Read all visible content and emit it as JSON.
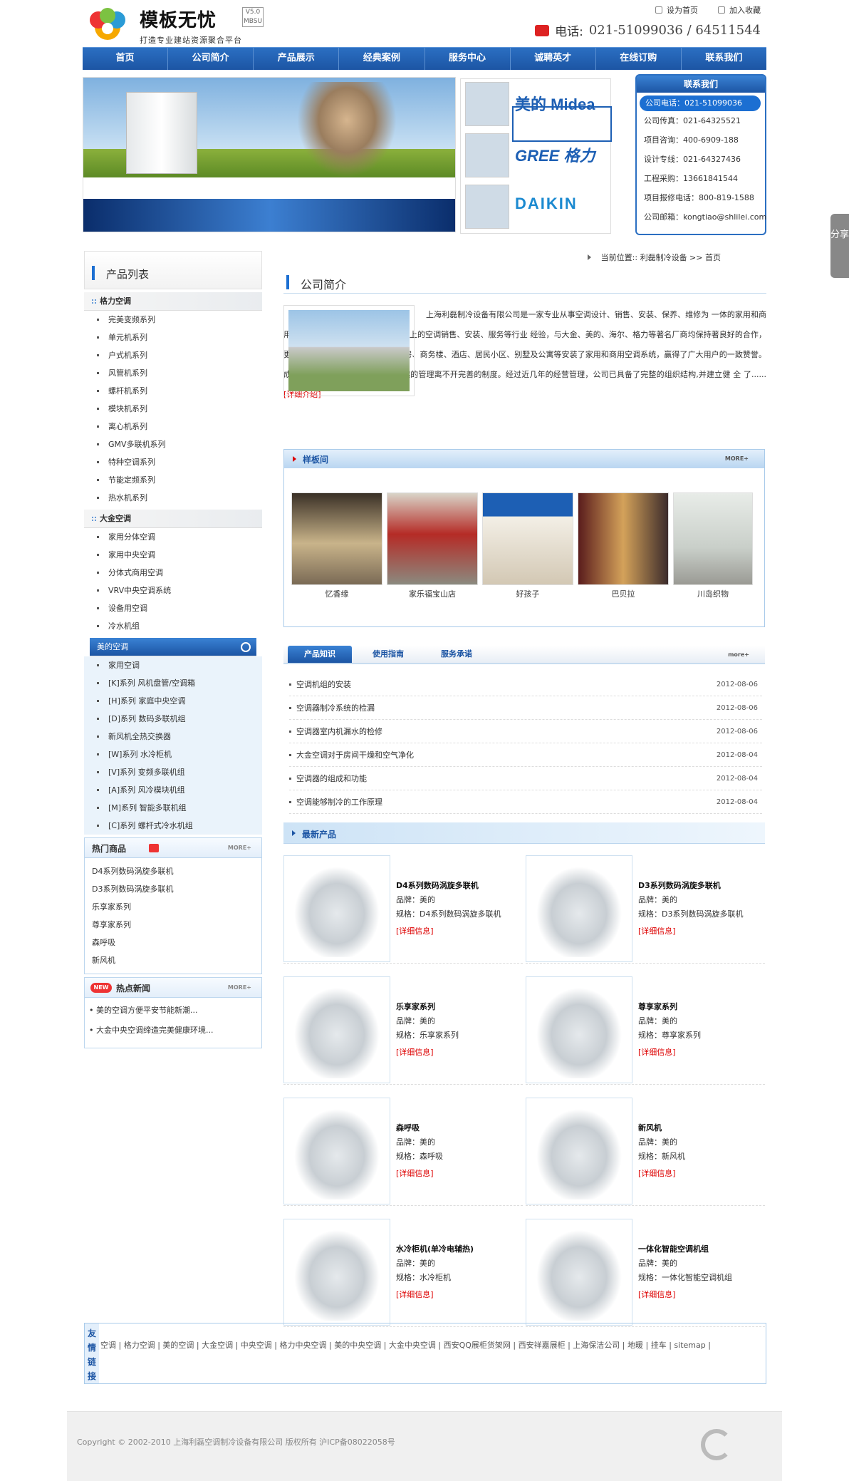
{
  "header": {
    "logo_title": "模板无忧",
    "logo_version": "V5.0 MBSU",
    "slogan": "打造专业建站资源聚合平台",
    "set_home": "设为首页",
    "favorite": "加入收藏",
    "phone_label": "电话:",
    "phone_number": "021-51099036 / 64511544"
  },
  "nav": [
    "首页",
    "公司简介",
    "产品展示",
    "经典案例",
    "服务中心",
    "诚聘英才",
    "在线订购",
    "联系我们"
  ],
  "banner": {
    "brands": [
      "美的 Midea",
      "GREE 格力",
      "DAIKIN"
    ]
  },
  "contact": {
    "title": "联系我们",
    "rows": [
      "公司电话：021-51099036",
      "公司传真：021-64325521",
      "项目咨询：400-6909-188",
      "设计专线：021-64327436",
      "工程采购：13661841544",
      "项目报修电话：800-819-1588",
      "公司邮箱：kongtiao@shlilei.com"
    ]
  },
  "share": "分享",
  "sidebar": {
    "title": "产品列表",
    "groups": [
      {
        "name": "格力空调",
        "items": [
          "完美变频系列",
          "单元机系列",
          "户式机系列",
          "风管机系列",
          "螺杆机系列",
          "模块机系列",
          "离心机系列",
          "GMV多联机系列",
          "特种空调系列",
          "节能定频系列",
          "热水机系列"
        ]
      },
      {
        "name": "大金空调",
        "items": [
          "家用分体空调",
          "家用中央空调",
          "分体式商用空调",
          "VRV中央空调系统",
          "设备用空调",
          "冷水机组"
        ]
      },
      {
        "name": "美的空调",
        "items": [
          "家用空调",
          "[K]系列 风机盘管/空调箱",
          "[H]系列 家庭中央空调",
          "[D]系列 数码多联机组",
          "新风机全热交换器",
          "[W]系列 水冷柜机",
          "[V]系列 变频多联机组",
          "[A]系列 风冷模块机组",
          "[M]系列 智能多联机组",
          "[C]系列 螺杆式冷水机组"
        ]
      }
    ],
    "hot_title": "热门商品",
    "hot_more": "MORE+",
    "hot_items": [
      "D4系列数码涡旋多联机",
      "D3系列数码涡旋多联机",
      "乐享家系列",
      "尊享家系列",
      "森呼吸",
      "新风机"
    ],
    "news_badge": "NEW",
    "news_title": "热点新闻",
    "news_more": "MORE+",
    "news_items": [
      "• 美的空调方便平安节能新潮...",
      "• 大金中央空调缔造完美健康环境..."
    ]
  },
  "main": {
    "crumb": "当前位置:: 利磊制冷设备 >> 首页",
    "about_title": "公司简介",
    "about_text": "上海利磊制冷设备有限公司是一家专业从事空调设计、销售、安装、保养、维修为 一体的家用和商用空调专业公司。本公司拥有十年以上的空调销售、安装、服务等行业 经验，与大金、美的、海尔、格力等著名厂商均保持著良好的合作，更以优质、高效的 服务，为众多厂房、商务楼、酒店、居民小区、别墅及公寓等安装了家用和商用空调系统，赢得了广大用户的一致赞誉。成功的企业来源于卓越的管理，卓越的管理离不开完善的制度。经过近几年的经营管理，公司已具备了完整的组织结构,并建立健 全 了......",
    "about_more": "[详细介绍]",
    "show_title": "样板间",
    "show_more": "MORE+",
    "show_items": [
      "忆香缘",
      "家乐福宝山店",
      "好孩子",
      "巴贝拉",
      "川岛织物"
    ],
    "tabs": [
      "产品知识",
      "使用指南",
      "服务承诺"
    ],
    "tabs_more": "more+",
    "news": [
      {
        "title": "空调机组的安装",
        "date": "2012-08-06"
      },
      {
        "title": "空调器制冷系统的检漏",
        "date": "2012-08-06"
      },
      {
        "title": "空调器室内机漏水的检修",
        "date": "2012-08-06"
      },
      {
        "title": "大金空调对于房间干燥和空气净化",
        "date": "2012-08-04"
      },
      {
        "title": "空调器的组成和功能",
        "date": "2012-08-04"
      },
      {
        "title": "空调能够制冷的工作原理",
        "date": "2012-08-04"
      }
    ],
    "products_title": "最新产品",
    "products": [
      {
        "name": "D4系列数码涡旋多联机",
        "brand": "品牌：美的",
        "spec": "规格：D4系列数码涡旋多联机"
      },
      {
        "name": "D3系列数码涡旋多联机",
        "brand": "品牌：美的",
        "spec": "规格：D3系列数码涡旋多联机"
      },
      {
        "name": "乐享家系列",
        "brand": "品牌：美的",
        "spec": "规格：乐享家系列"
      },
      {
        "name": "尊享家系列",
        "brand": "品牌：美的",
        "spec": "规格：尊享家系列"
      },
      {
        "name": "森呼吸",
        "brand": "品牌：美的",
        "spec": "规格：森呼吸"
      },
      {
        "name": "新风机",
        "brand": "品牌：美的",
        "spec": "规格：新风机"
      },
      {
        "name": "水冷柜机(单冷电辅热)",
        "brand": "品牌：美的",
        "spec": "规格：水冷柜机"
      },
      {
        "name": "一体化智能空调机组",
        "brand": "品牌：美的",
        "spec": "规格：一体化智能空调机组"
      }
    ],
    "product_detail": "[详细信息]"
  },
  "links": {
    "label": "友情链接",
    "text": "空调 | 格力空调 | 美的空调 | 大金空调 | 中央空调 | 格力中央空调 | 美的中央空调 | 大金中央空调 | 西安QQ展柜货架网 | 西安祥嘉展柜 | 上海保洁公司 | 地暖 | 挂车 | sitemap |"
  },
  "footer": {
    "copyright": "Copyright © 2002-2010 上海利磊空调制冷设备有限公司 版权所有 沪ICP备08022058号"
  }
}
